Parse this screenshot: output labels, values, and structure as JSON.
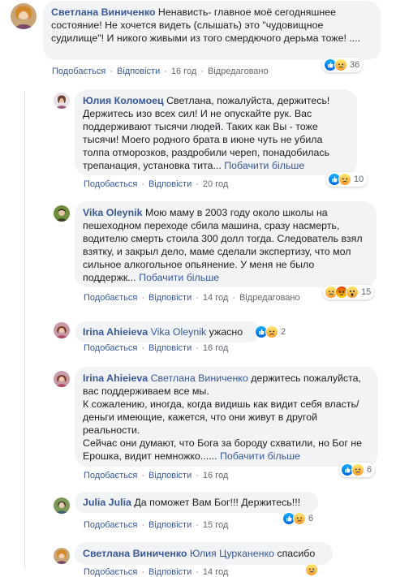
{
  "colors": {
    "link": "#385898",
    "bubble": "#f2f3f5",
    "meta": "#606770"
  },
  "actions": {
    "like": "Подобається",
    "reply": "Відповісти",
    "edited": "Відредаговано",
    "see_more": "Побачити більше"
  },
  "comments": [
    {
      "author": "Светлана Виниченко",
      "text": "Ненависть- главное моё сегодняшнее состояние! Не хочется видеть (слышать) это \"чудовищное судилище\"! И никого живыми из того смердючого дерьма тоже! ....",
      "time": "16 год",
      "edited": true,
      "reactions": [
        "like-icon",
        "sad-icon"
      ],
      "count": "36"
    },
    {
      "author": "Юлия Коломоец",
      "text": "Светлана, пожалуйста, держитесь! Держитесь изо всех сил! И не опускайте рук. Вас поддерживают тысячи людей. Таких как Вы - тоже тысячи! Моего родного брата в июне чуть не убила толпа отморозков, раздробили череп, понадобилась трепанация, установка тита...",
      "time": "20 год",
      "edited": false,
      "reactions": [
        "like-icon",
        "sad-icon"
      ],
      "count": "10"
    },
    {
      "author": "Vika Oleynik",
      "text": "Мою маму в 2003 году около школы на пешеходном переходе сбила машина, сразу насмерть, водителю смерть стоила 300 долл тогда. Следователь взял взятку, и закрыл дело, маме сделали экспертизу, что мол сильное алкогольное опьянение. У меня не было поддержк...",
      "time": "14 год",
      "edited": true,
      "reactions": [
        "sad-icon",
        "angry-icon",
        "wow-icon"
      ],
      "count": "15"
    },
    {
      "author": "Irina Ahieieva",
      "mention": "Vika Oleynik",
      "text": "ужасно",
      "time": "16 год",
      "edited": false,
      "reactions": [
        "like-icon",
        "sad-icon"
      ],
      "count": "2"
    },
    {
      "author": "Irina Ahieieva",
      "mention": "Светлана Виниченко",
      "text_a": "держитесь пожалуйста, вас поддерживаем все мы.",
      "text_b": "К сожалению, иногда, когда видишь как видит себя власть/деньги имеющие, кажется, что они живут в другой реальности.",
      "text_c": "Сейчас они думают, что Бога за бороду схватили, но Бог не Ерошка, видит немножко......",
      "time": "16 год",
      "edited": false,
      "reactions": [
        "like-icon",
        "sad-icon"
      ],
      "count": "6"
    },
    {
      "author": "Julia Julia",
      "text": "Да поможет Вам Бог!!! Держитесь!!!",
      "time": "15 год",
      "edited": false,
      "reactions": [
        "like-icon",
        "sad-icon"
      ],
      "count": "6"
    },
    {
      "author": "Светлана Виниченко",
      "mention": "Юлия Цурканенко",
      "text": "спасибо",
      "time": "14 год",
      "edited": false,
      "reactions": [
        "sad-icon"
      ],
      "count": ""
    }
  ]
}
